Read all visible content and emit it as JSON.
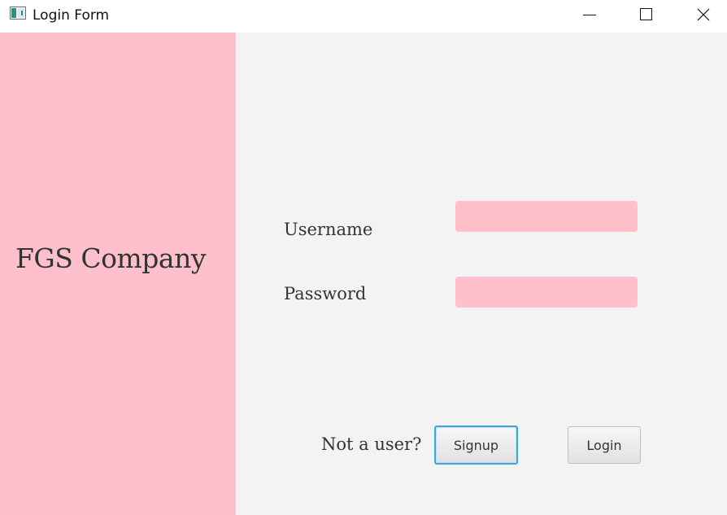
{
  "window": {
    "title": "Login Form",
    "controls": {
      "minimize_icon": "minimize-icon",
      "maximize_icon": "maximize-icon",
      "close_icon": "close-icon"
    }
  },
  "sidebar": {
    "company_name": "FGS Company",
    "background_color": "#ffc0cb"
  },
  "form": {
    "username_label": "Username",
    "username_value": "",
    "password_label": "Password",
    "password_value": "",
    "field_color": "#ffc0cb"
  },
  "footer": {
    "prompt_text": "Not a user?",
    "signup_label": "Signup",
    "login_label": "Login"
  }
}
